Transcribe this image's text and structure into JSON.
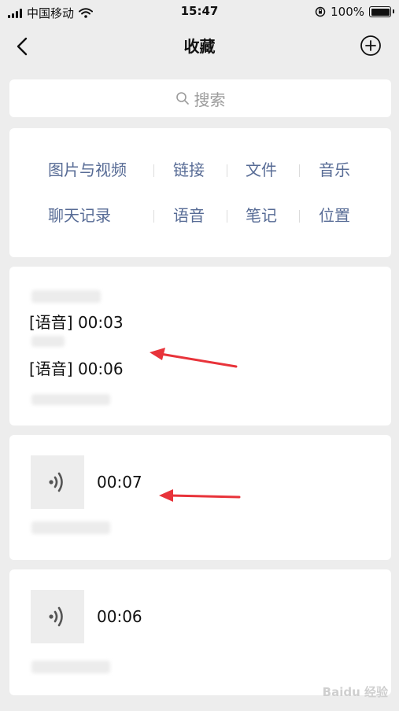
{
  "status_bar": {
    "carrier": "中国移动",
    "time": "15:47",
    "battery_percent": "100%",
    "battery_level": 1.0
  },
  "nav": {
    "title": "收藏"
  },
  "search": {
    "placeholder": "搜索"
  },
  "categories": {
    "row1": [
      "图片与视频",
      "链接",
      "文件",
      "音乐"
    ],
    "row2": [
      "聊天记录",
      "语音",
      "笔记",
      "位置"
    ]
  },
  "favorites": [
    {
      "type": "chat-record",
      "lines": [
        "[语音] 00:03",
        "[语音] 00:06"
      ]
    },
    {
      "type": "voice",
      "duration": "00:07"
    },
    {
      "type": "voice",
      "duration": "00:06"
    }
  ],
  "colors": {
    "background": "#ededed",
    "category_text": "#576b95",
    "annotation_arrow": "#e8333a"
  },
  "watermark": "Baidu 经验"
}
